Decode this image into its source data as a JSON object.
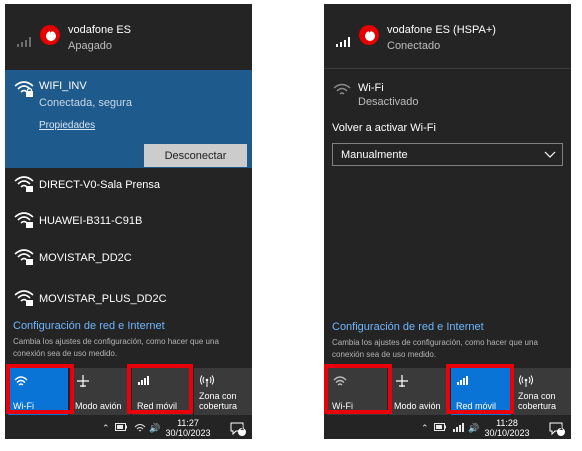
{
  "left": {
    "carrier": {
      "name": "vodafone ES",
      "status": "Apagado"
    },
    "connected_network": {
      "name": "WIFI_INV",
      "status": "Conectada, segura",
      "properties_link": "Propiedades",
      "disconnect_label": "Desconectar"
    },
    "networks": [
      {
        "name": "DIRECT-V0-Sala Prensa"
      },
      {
        "name": "HUAWEI-B311-C91B"
      },
      {
        "name": "MOVISTAR_DD2C"
      },
      {
        "name": "MOVISTAR_PLUS_DD2C"
      }
    ],
    "settings": {
      "title": "Configuración de red e Internet",
      "description": "Cambia los ajustes de configuración, como hacer que una conexión sea de uso medido."
    },
    "tiles": [
      {
        "label": "Wi-Fi",
        "active": true,
        "icon": "wifi-icon"
      },
      {
        "label": "Modo avión",
        "active": false,
        "icon": "airplane-icon"
      },
      {
        "label": "Red móvil",
        "active": false,
        "icon": "cellular-icon"
      },
      {
        "label": "Zona con cobertura",
        "active": false,
        "icon": "hotspot-icon"
      }
    ],
    "taskbar": {
      "time": "11:27",
      "date": "30/10/2023",
      "notifications": "1"
    }
  },
  "right": {
    "carrier": {
      "name": "vodafone ES (HSPA+)",
      "status": "Conectado"
    },
    "wifi": {
      "name": "Wi-Fi",
      "status": "Desactivado"
    },
    "reenable": {
      "label": "Volver a activar Wi-Fi",
      "selected": "Manualmente"
    },
    "settings": {
      "title": "Configuración de red e Internet",
      "description": "Cambia los ajustes de configuración, como hacer que una conexión sea de uso medido."
    },
    "tiles": [
      {
        "label": "Wi-Fi",
        "active": false,
        "icon": "wifi-icon"
      },
      {
        "label": "Modo avión",
        "active": false,
        "icon": "airplane-icon"
      },
      {
        "label": "Red móvil",
        "active": true,
        "icon": "cellular-icon"
      },
      {
        "label": "Zona con cobertura",
        "active": false,
        "icon": "hotspot-icon"
      }
    ],
    "taskbar": {
      "time": "11:28",
      "date": "30/10/2023",
      "notifications": "1"
    }
  },
  "colors": {
    "panel_bg": "#242424",
    "selected_bg": "#1e5a8c",
    "active_tile": "#0a74d6",
    "link": "#6fb6ff",
    "highlight": "#e8000b"
  }
}
